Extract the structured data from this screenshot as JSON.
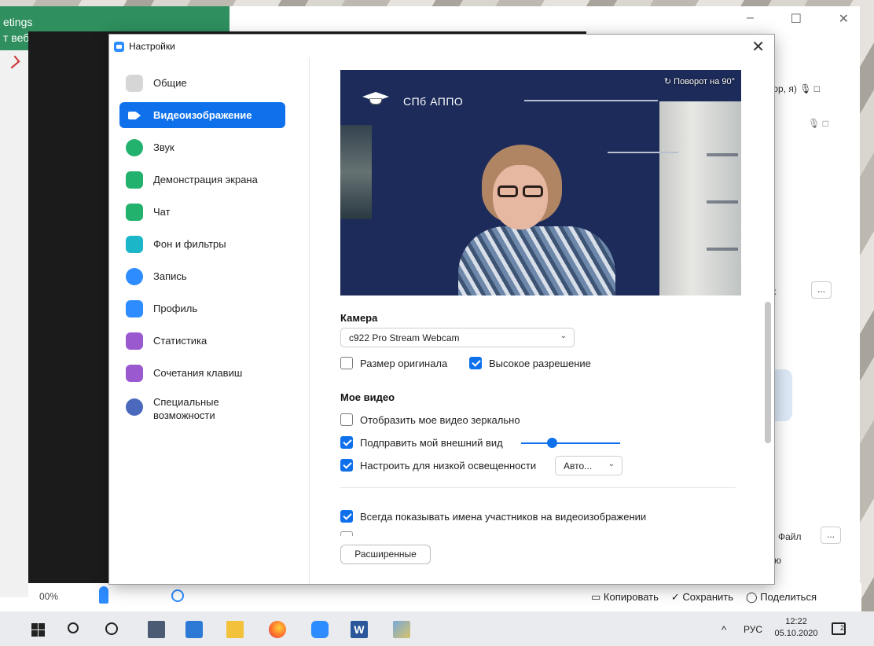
{
  "background": {
    "green_bar_line1": "etings",
    "green_bar_line2": "т веб-камеру",
    "right_panel": {
      "row1": "тор, я)",
      "letter": "к",
      "more1": "...",
      "file_label": "Файл",
      "more2": "...",
      "bottom_text": "лю"
    },
    "bottom_bar": {
      "zoom_value": "00%",
      "actions": [
        "Копировать",
        "Сохранить",
        "Поделиться"
      ]
    }
  },
  "window_controls": {
    "minimize": "–",
    "maximize": "☐",
    "close": "✕"
  },
  "dialog": {
    "title": "Настройки",
    "close": "✕"
  },
  "sidebar": {
    "items": [
      {
        "label": "Общие",
        "color": "#d6d6d6",
        "icon": "gear-icon"
      },
      {
        "label": "Видеоизображение",
        "color": "#0e71eb",
        "icon": "video-icon",
        "active": true
      },
      {
        "label": "Звук",
        "color": "#23b26d",
        "icon": "headphones-icon"
      },
      {
        "label": "Демонстрация экрана",
        "color": "#23b26d",
        "icon": "share-screen-icon"
      },
      {
        "label": "Чат",
        "color": "#23b26d",
        "icon": "chat-icon"
      },
      {
        "label": "Фон и фильтры",
        "color": "#1bb7c9",
        "icon": "background-icon"
      },
      {
        "label": "Запись",
        "color": "#2d8cff",
        "icon": "record-icon"
      },
      {
        "label": "Профиль",
        "color": "#2d8cff",
        "icon": "profile-icon"
      },
      {
        "label": "Статистика",
        "color": "#9b59d0",
        "icon": "statistics-icon"
      },
      {
        "label": "Сочетания клавиш",
        "color": "#9b59d0",
        "icon": "keyboard-icon"
      },
      {
        "label": "Специальные возможности",
        "color": "#4a69bd",
        "icon": "accessibility-icon"
      }
    ]
  },
  "preview": {
    "logo_text": "СПб АППО",
    "rotate": "↻ Поворот на 90°"
  },
  "camera": {
    "heading": "Камера",
    "selected": "c922 Pro Stream Webcam",
    "original_size": {
      "label": "Размер оригинала",
      "checked": false
    },
    "hd": {
      "label": "Высокое разрешение",
      "checked": true
    }
  },
  "my_video": {
    "heading": "Мое видео",
    "mirror": {
      "label": "Отобразить мое видео зеркально",
      "checked": false
    },
    "touch_up": {
      "label": "Подправить мой внешний вид",
      "checked": true,
      "level": 0.26
    },
    "low_light": {
      "label": "Настроить для низкой освещенности",
      "checked": true,
      "mode": "Авто..."
    }
  },
  "always_show_names": {
    "label": "Всегда показывать имена участников на видеоизображении",
    "checked": true
  },
  "advanced_button": "Расширенные",
  "taskbar": {
    "caret": "^",
    "lang": "РУС",
    "time": "12:22",
    "date": "05.10.2020",
    "notifications": "2",
    "word_letter": "W"
  }
}
